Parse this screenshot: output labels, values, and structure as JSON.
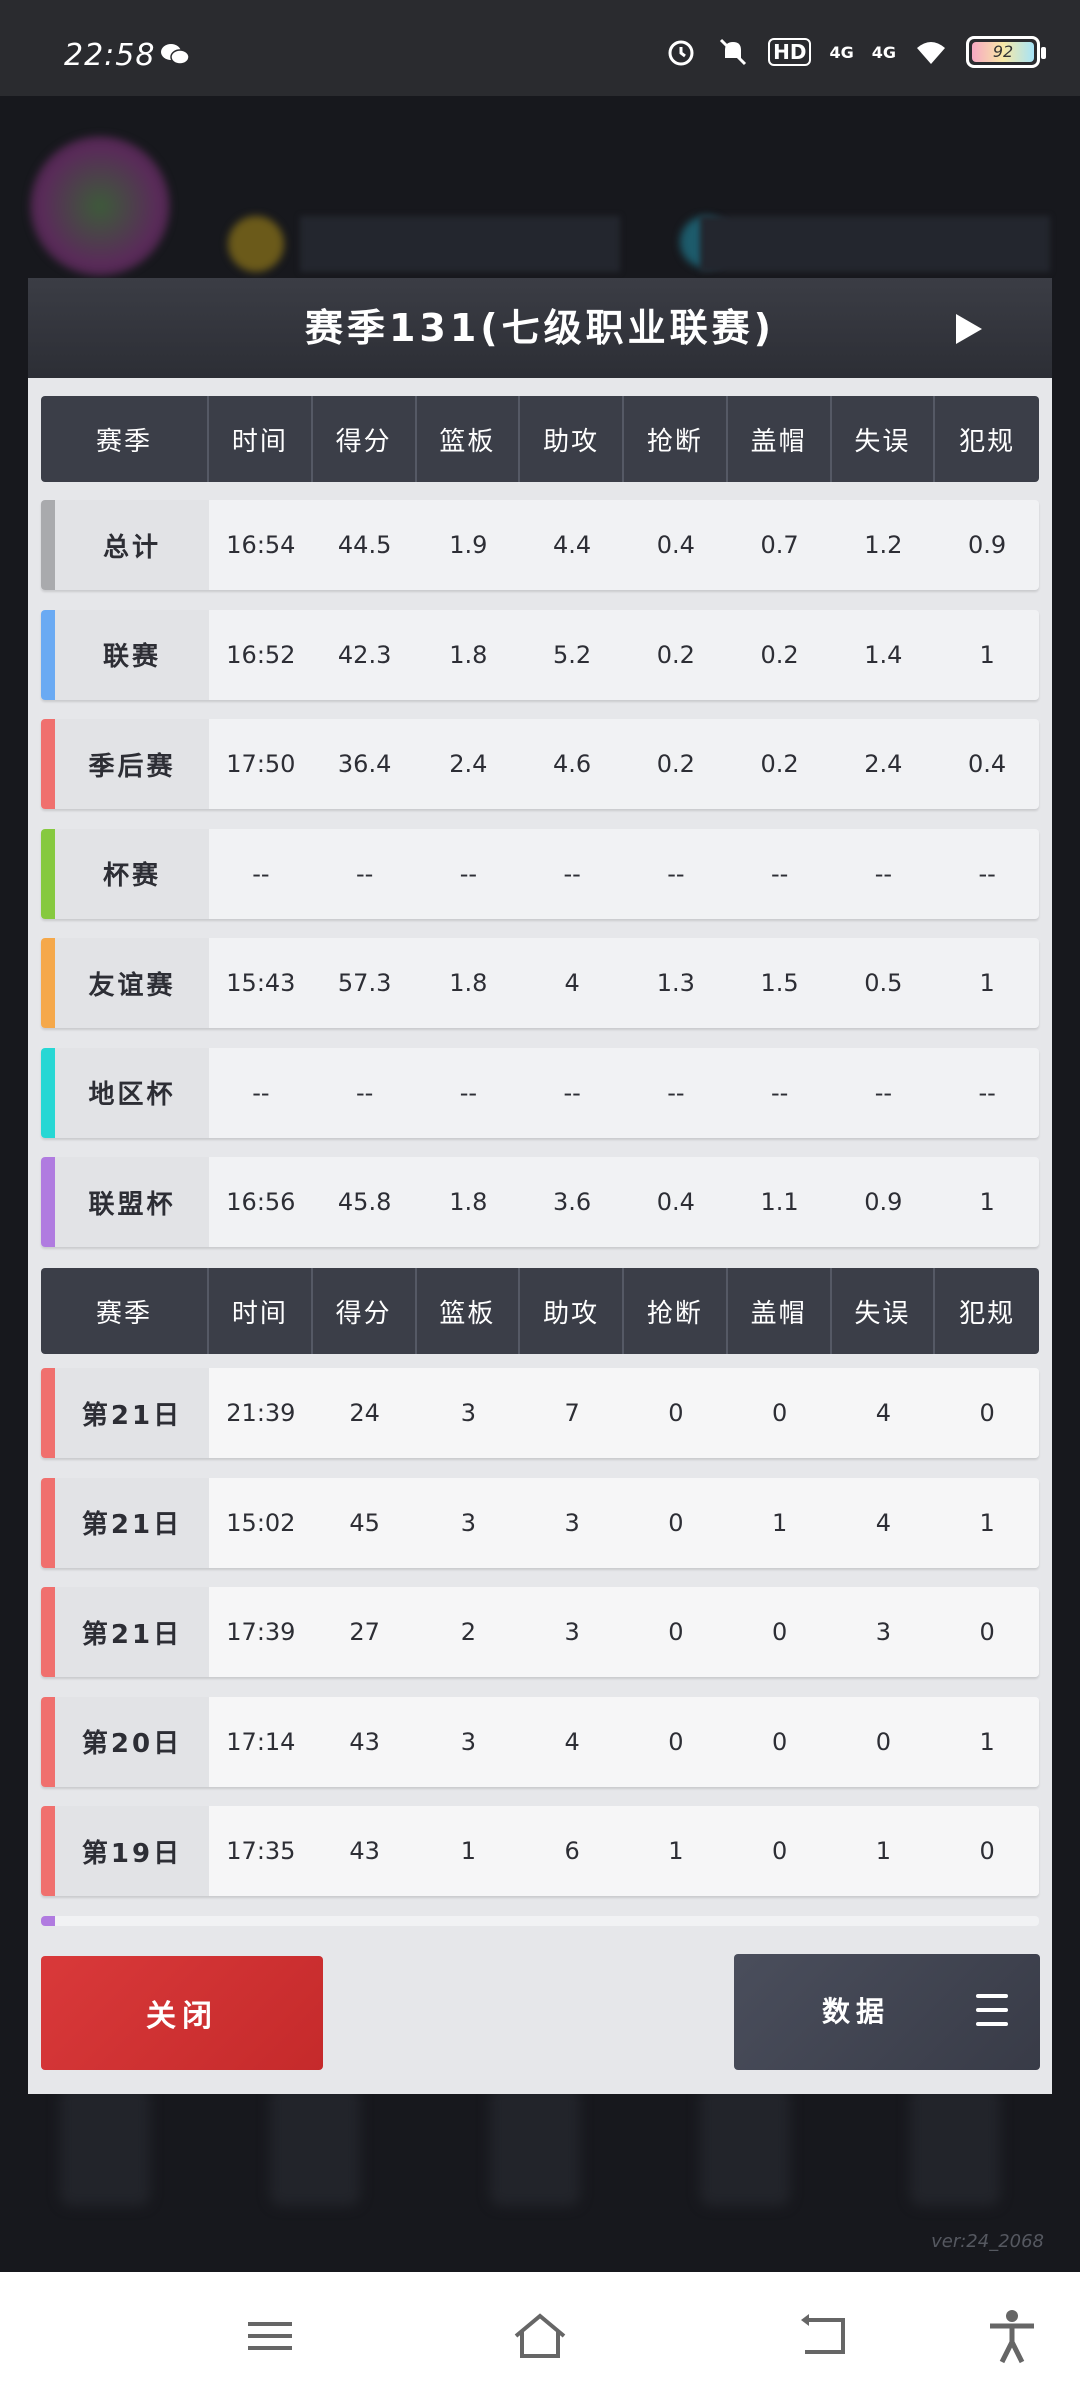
{
  "status_bar": {
    "time": "22:58",
    "icons": [
      "wechat-icon",
      "alarm-icon",
      "mute-icon",
      "hd-icon",
      "signal-4g-icon",
      "signal-4g-icon",
      "wifi-icon"
    ],
    "hd_label": "HD",
    "signal_label": "4G",
    "battery": "92"
  },
  "background": {
    "version": "ver:24_2068"
  },
  "dialog": {
    "title": "赛季131(七级职业联赛)",
    "summary_header": [
      "赛季",
      "时间",
      "得分",
      "篮板",
      "助攻",
      "抢断",
      "盖帽",
      "失误",
      "犯规"
    ],
    "summary_rows": [
      {
        "label": "总计",
        "color": "#a9aaad",
        "values": [
          "16:54",
          "44.5",
          "1.9",
          "4.4",
          "0.4",
          "0.7",
          "1.2",
          "0.9"
        ]
      },
      {
        "label": "联赛",
        "color": "#6aaaf3",
        "values": [
          "16:52",
          "42.3",
          "1.8",
          "5.2",
          "0.2",
          "0.2",
          "1.4",
          "1"
        ]
      },
      {
        "label": "季后赛",
        "color": "#f0706e",
        "values": [
          "17:50",
          "36.4",
          "2.4",
          "4.6",
          "0.2",
          "0.2",
          "2.4",
          "0.4"
        ]
      },
      {
        "label": "杯赛",
        "color": "#86c93f",
        "values": [
          "--",
          "--",
          "--",
          "--",
          "--",
          "--",
          "--",
          "--"
        ]
      },
      {
        "label": "友谊赛",
        "color": "#f5a84a",
        "values": [
          "15:43",
          "57.3",
          "1.8",
          "4",
          "1.3",
          "1.5",
          "0.5",
          "1"
        ]
      },
      {
        "label": "地区杯",
        "color": "#27d7d4",
        "values": [
          "--",
          "--",
          "--",
          "--",
          "--",
          "--",
          "--",
          "--"
        ]
      },
      {
        "label": "联盟杯",
        "color": "#b07be0",
        "values": [
          "16:56",
          "45.8",
          "1.8",
          "3.6",
          "0.4",
          "1.1",
          "0.9",
          "1"
        ]
      }
    ],
    "games_header": [
      "赛季",
      "时间",
      "得分",
      "篮板",
      "助攻",
      "抢断",
      "盖帽",
      "失误",
      "犯规"
    ],
    "game_rows": [
      {
        "label": "第21日",
        "color": "#f0706e",
        "values": [
          "21:39",
          "24",
          "3",
          "7",
          "0",
          "0",
          "4",
          "0"
        ]
      },
      {
        "label": "第21日",
        "color": "#f0706e",
        "values": [
          "15:02",
          "45",
          "3",
          "3",
          "0",
          "1",
          "4",
          "1"
        ]
      },
      {
        "label": "第21日",
        "color": "#f0706e",
        "values": [
          "17:39",
          "27",
          "2",
          "3",
          "0",
          "0",
          "3",
          "0"
        ]
      },
      {
        "label": "第20日",
        "color": "#f0706e",
        "values": [
          "17:14",
          "43",
          "3",
          "4",
          "0",
          "0",
          "0",
          "1"
        ]
      },
      {
        "label": "第19日",
        "color": "#f0706e",
        "values": [
          "17:35",
          "43",
          "1",
          "6",
          "1",
          "0",
          "1",
          "0"
        ]
      }
    ],
    "close_label": "关闭",
    "data_label": "数据"
  },
  "navbar": {
    "buttons": [
      "menu-icon",
      "home-icon",
      "back-icon",
      "accessibility-icon"
    ]
  }
}
